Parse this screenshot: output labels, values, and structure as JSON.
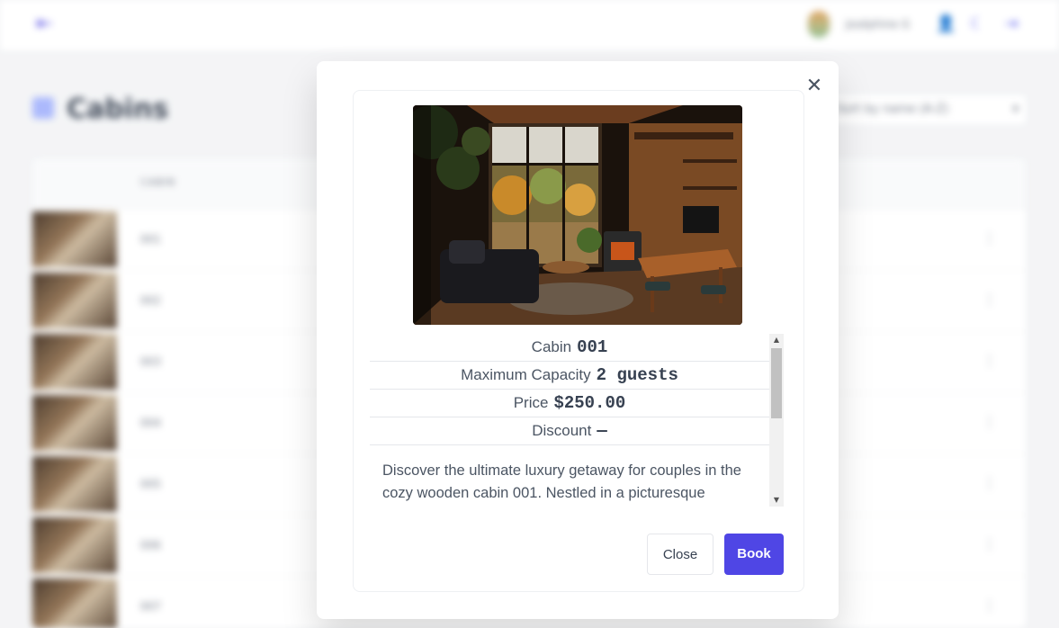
{
  "header": {
    "user_name": "Joséphine G",
    "icons": [
      "collapse-sidebar-icon",
      "user-icon",
      "moon-icon",
      "logout-icon"
    ]
  },
  "page": {
    "title": "Cabins",
    "sort_label": "Sort by name (A-Z)"
  },
  "table": {
    "column_cabin": "CABIN",
    "rows": [
      "001",
      "002",
      "003",
      "004",
      "005",
      "006",
      "007"
    ]
  },
  "modal": {
    "cabin_label": "Cabin",
    "cabin_value": "001",
    "capacity_label": "Maximum Capacity",
    "capacity_value": "2 guests",
    "price_label": "Price",
    "price_value": "$250.00",
    "discount_label": "Discount",
    "discount_value": "—",
    "description": "Discover the ultimate luxury getaway for couples in the cozy wooden cabin 001. Nestled in a picturesque",
    "close_button": "Close",
    "book_button": "Book"
  },
  "colors": {
    "accent": "#4f46e5",
    "background": "#f3f4f6"
  }
}
